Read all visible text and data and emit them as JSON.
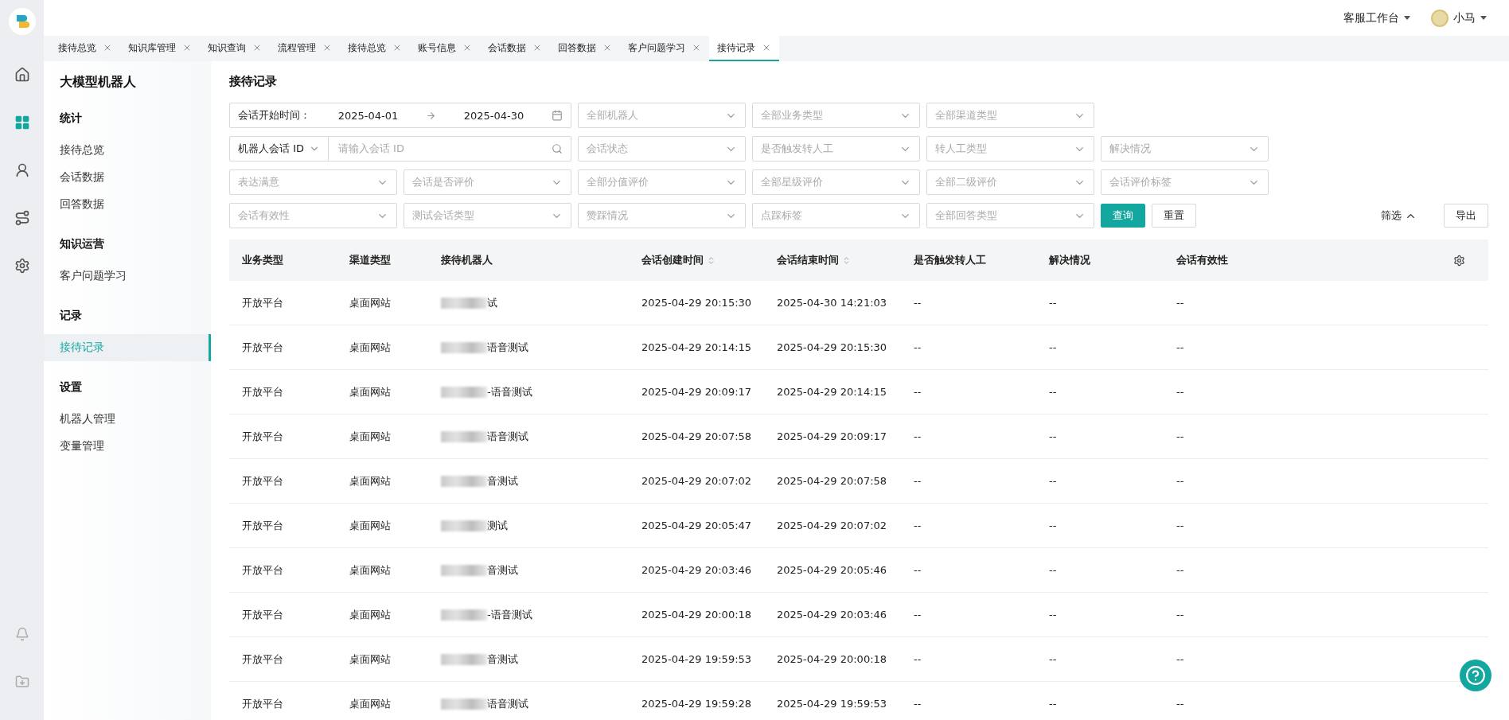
{
  "top_bar": {
    "workspace": "客服工作台",
    "user": "小马"
  },
  "rail": [
    {
      "kind": "home",
      "selected": false
    },
    {
      "kind": "apps",
      "selected": true
    },
    {
      "kind": "person",
      "selected": false
    },
    {
      "kind": "flow",
      "selected": false
    },
    {
      "kind": "settings",
      "selected": false
    }
  ],
  "rail_bottom": [
    {
      "kind": "bell"
    },
    {
      "kind": "download"
    }
  ],
  "tabs": [
    {
      "label": "接待总览",
      "selected": false
    },
    {
      "label": "知识库管理",
      "selected": false
    },
    {
      "label": "知识查询",
      "selected": false
    },
    {
      "label": "流程管理",
      "selected": false
    },
    {
      "label": "接待总览",
      "selected": false
    },
    {
      "label": "账号信息",
      "selected": false
    },
    {
      "label": "会话数据",
      "selected": false
    },
    {
      "label": "回答数据",
      "selected": false
    },
    {
      "label": "客户问题学习",
      "selected": false
    },
    {
      "label": "接待记录",
      "selected": true
    }
  ],
  "sidebar": {
    "title": "大模型机器人",
    "sections": [
      {
        "heading": "统计",
        "items": [
          {
            "label": "接待总览",
            "selected": false
          },
          {
            "label": "会话数据",
            "selected": false
          },
          {
            "label": "回答数据",
            "selected": false
          }
        ]
      },
      {
        "heading": "知识运营",
        "items": [
          {
            "label": "客户问题学习",
            "selected": false
          }
        ]
      },
      {
        "heading": "记录",
        "items": [
          {
            "label": "接待记录",
            "selected": true
          }
        ]
      },
      {
        "heading": "设置",
        "items": [
          {
            "label": "机器人管理",
            "selected": false
          },
          {
            "label": "变量管理",
            "selected": false
          }
        ]
      }
    ]
  },
  "page_title": "接待记录",
  "filter_rows": [
    [
      {
        "kind": "date",
        "label": "会话开始时间：",
        "start": "2025-04-01",
        "end": "2025-04-30"
      },
      {
        "kind": "select",
        "placeholder": "全部机器人"
      },
      {
        "kind": "select",
        "placeholder": "全部业务类型"
      },
      {
        "kind": "select",
        "placeholder": "全部渠道类型"
      }
    ],
    [
      {
        "kind": "id",
        "prefix": "机器人会话 ID",
        "placeholder": "请输入会话 ID"
      },
      {
        "kind": "select",
        "placeholder": "会话状态"
      },
      {
        "kind": "select",
        "placeholder": "是否触发转人工"
      },
      {
        "kind": "select",
        "placeholder": "转人工类型"
      },
      {
        "kind": "select",
        "placeholder": "解决情况"
      }
    ],
    [
      {
        "kind": "select",
        "placeholder": "表达满意"
      },
      {
        "kind": "select",
        "placeholder": "会话是否评价"
      },
      {
        "kind": "select",
        "placeholder": "全部分值评价"
      },
      {
        "kind": "select",
        "placeholder": "全部星级评价"
      },
      {
        "kind": "select",
        "placeholder": "全部二级评价"
      },
      {
        "kind": "select",
        "placeholder": "会话评价标签"
      }
    ],
    [
      {
        "kind": "select",
        "placeholder": "会话有效性"
      },
      {
        "kind": "select",
        "placeholder": "测试会话类型"
      },
      {
        "kind": "select",
        "placeholder": "赞踩情况"
      },
      {
        "kind": "select",
        "placeholder": "点踩标签"
      },
      {
        "kind": "select",
        "placeholder": "全部回答类型"
      },
      {
        "kind": "primary",
        "label": "查询"
      },
      {
        "kind": "default",
        "label": "重置"
      }
    ]
  ],
  "filter_toggle": {
    "label": "筛选",
    "expanded": true
  },
  "export_button": "导出",
  "table": {
    "columns": [
      {
        "label": "业务类型",
        "sortable": false,
        "kind": "text"
      },
      {
        "label": "渠道类型",
        "sortable": false,
        "kind": "text"
      },
      {
        "label": "接待机器人",
        "sortable": false,
        "kind": "masked"
      },
      {
        "label": "会话创建时间",
        "sortable": true,
        "kind": "text"
      },
      {
        "label": "会话结束时间",
        "sortable": true,
        "kind": "text"
      },
      {
        "label": "是否触发转人工",
        "sortable": false,
        "kind": "text"
      },
      {
        "label": "解决情况",
        "sortable": false,
        "kind": "text"
      },
      {
        "label": "会话有效性",
        "sortable": false,
        "kind": "text"
      }
    ],
    "rows": [
      [
        "开放平台",
        "桌面网站",
        "试",
        "2025-04-29 20:15:30",
        "2025-04-30 14:21:03",
        "--",
        "--",
        "--"
      ],
      [
        "开放平台",
        "桌面网站",
        "语音测试",
        "2025-04-29 20:14:15",
        "2025-04-29 20:15:30",
        "--",
        "--",
        "--"
      ],
      [
        "开放平台",
        "桌面网站",
        "-语音测试",
        "2025-04-29 20:09:17",
        "2025-04-29 20:14:15",
        "--",
        "--",
        "--"
      ],
      [
        "开放平台",
        "桌面网站",
        "语音测试",
        "2025-04-29 20:07:58",
        "2025-04-29 20:09:17",
        "--",
        "--",
        "--"
      ],
      [
        "开放平台",
        "桌面网站",
        "音测试",
        "2025-04-29 20:07:02",
        "2025-04-29 20:07:58",
        "--",
        "--",
        "--"
      ],
      [
        "开放平台",
        "桌面网站",
        "测试",
        "2025-04-29 20:05:47",
        "2025-04-29 20:07:02",
        "--",
        "--",
        "--"
      ],
      [
        "开放平台",
        "桌面网站",
        "音测试",
        "2025-04-29 20:03:46",
        "2025-04-29 20:05:46",
        "--",
        "--",
        "--"
      ],
      [
        "开放平台",
        "桌面网站",
        "-语音测试",
        "2025-04-29 20:00:18",
        "2025-04-29 20:03:46",
        "--",
        "--",
        "--"
      ],
      [
        "开放平台",
        "桌面网站",
        "音测试",
        "2025-04-29 19:59:53",
        "2025-04-29 20:00:18",
        "--",
        "--",
        "--"
      ],
      [
        "开放平台",
        "桌面网站",
        "语音测试",
        "2025-04-29 19:59:28",
        "2025-04-29 19:59:53",
        "--",
        "--",
        "--"
      ]
    ]
  }
}
